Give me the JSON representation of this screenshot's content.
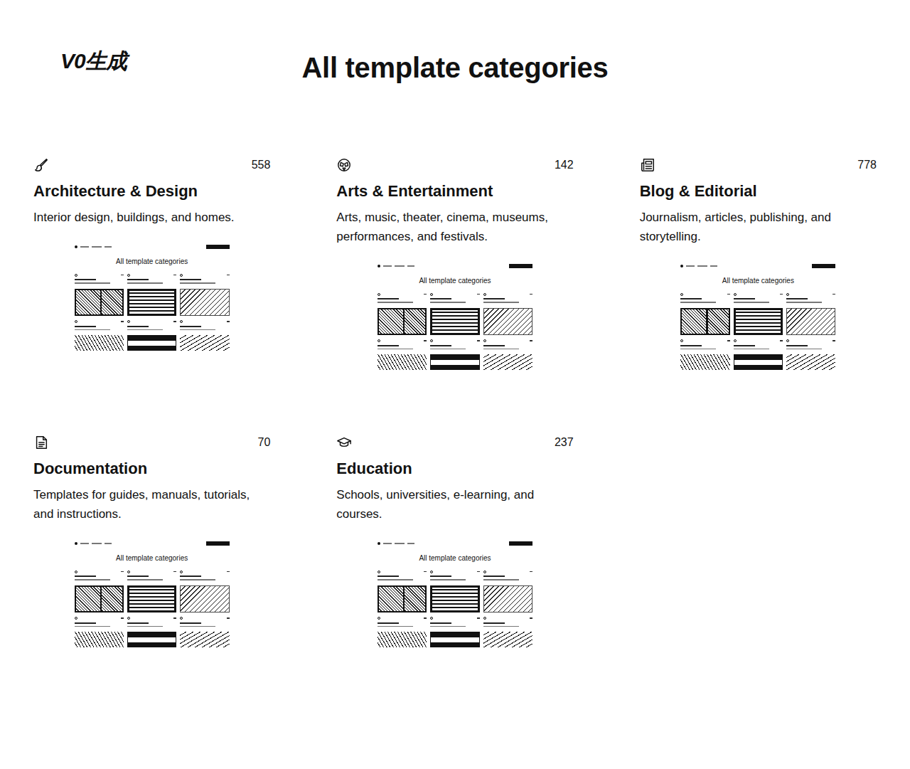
{
  "header": {
    "badge": "V0生成",
    "title": "All template categories"
  },
  "categories": [
    {
      "name": "Architecture & Design",
      "count": "558",
      "description": "Interior design, buildings, and homes.",
      "preview": {
        "title": "All template categories"
      }
    },
    {
      "name": "Arts & Entertainment",
      "count": "142",
      "description": "Arts, music, theater, cinema, museums, performances, and festivals.",
      "preview": {
        "title": "All template categories"
      }
    },
    {
      "name": "Blog & Editorial",
      "count": "778",
      "description": "Journalism, articles, publishing, and storytelling.",
      "preview": {
        "title": "All template categories"
      }
    },
    {
      "name": "Documentation",
      "count": "70",
      "description": "Templates for guides, manuals, tutorials, and instructions.",
      "preview": {
        "title": "All template categories"
      }
    },
    {
      "name": "Education",
      "count": "237",
      "description": "Schools, universities, e-learning, and courses.",
      "preview": {
        "title": "All template categories"
      }
    }
  ]
}
